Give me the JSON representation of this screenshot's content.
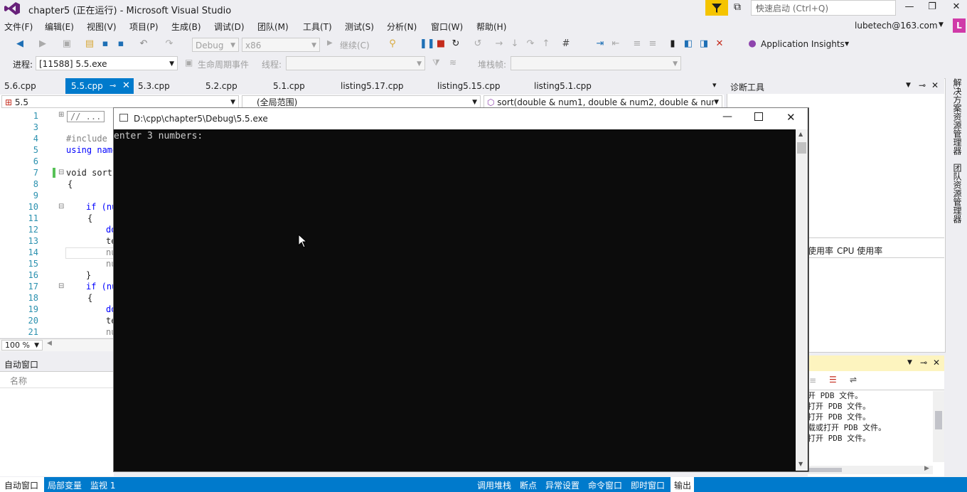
{
  "titlebar": {
    "title": "chapter5 (正在运行) - Microsoft Visual Studio",
    "quick_launch": "快速启动 (Ctrl+Q)",
    "minimize": "—",
    "maximize": "❐",
    "close": "✕"
  },
  "menu": [
    "文件(F)",
    "编辑(E)",
    "视图(V)",
    "项目(P)",
    "生成(B)",
    "调试(D)",
    "团队(M)",
    "工具(T)",
    "测试(S)",
    "分析(N)",
    "窗口(W)",
    "帮助(H)"
  ],
  "account": {
    "email": "lubetech@163.com",
    "avatar": "L"
  },
  "toolbar": {
    "config": "Debug",
    "platform": "x86",
    "continue": "继续(C)",
    "app_insights": "Application Insights"
  },
  "debugbar": {
    "process_label": "进程:",
    "process_value": "[11588] 5.5.exe",
    "lifecycle": "生命周期事件",
    "thread_label": "线程:",
    "stack_label": "堆栈帧:"
  },
  "tabs": [
    "5.6.cpp",
    "5.5.cpp",
    "5.3.cpp",
    "5.2.cpp",
    "5.1.cpp",
    "listing5.17.cpp",
    "listing5.15.cpp",
    "listing5.1.cpp"
  ],
  "navbar": {
    "project": "5.5",
    "scope": "(全局范围)",
    "member": "sort(double & num1, double & num2, double & nur"
  },
  "editor": {
    "lines": [
      "1",
      "3",
      "4",
      "5",
      "6",
      "7",
      "8",
      "9",
      "10",
      "11",
      "12",
      "13",
      "14",
      "15",
      "16",
      "17",
      "18",
      "19",
      "20",
      "21"
    ],
    "code": [
      "// ...",
      "",
      "#include",
      "using name",
      "",
      "void sort",
      "{",
      "",
      "if (nu",
      "{",
      "do",
      "te",
      "nu",
      "nu",
      "}",
      "if (nu",
      "{",
      "do",
      "te",
      "nu"
    ],
    "zoom": "100 %"
  },
  "diag": {
    "title": "诊断工具",
    "mem_label": "使用率",
    "cpu_label": "CPU 使用率"
  },
  "sidebar": {
    "solution": "解决方案资源管理器",
    "team": "团队资源管理器"
  },
  "auto": {
    "title": "自动窗口",
    "col_name": "名称"
  },
  "output": {
    "lines": [
      "开 PDB 文件。",
      "打开 PDB 文件。",
      "打开 PDB 文件。",
      "载或打开 PDB 文件。",
      "打开 PDB 文件。"
    ]
  },
  "bottom_left": [
    "自动窗口",
    "局部变量",
    "监视 1"
  ],
  "bottom_right": [
    "调用堆栈",
    "断点",
    "异常设置",
    "命令窗口",
    "即时窗口",
    "输出"
  ],
  "console": {
    "title": "D:\\cpp\\chapter5\\Debug\\5.5.exe",
    "text": "enter 3 numbers:"
  }
}
